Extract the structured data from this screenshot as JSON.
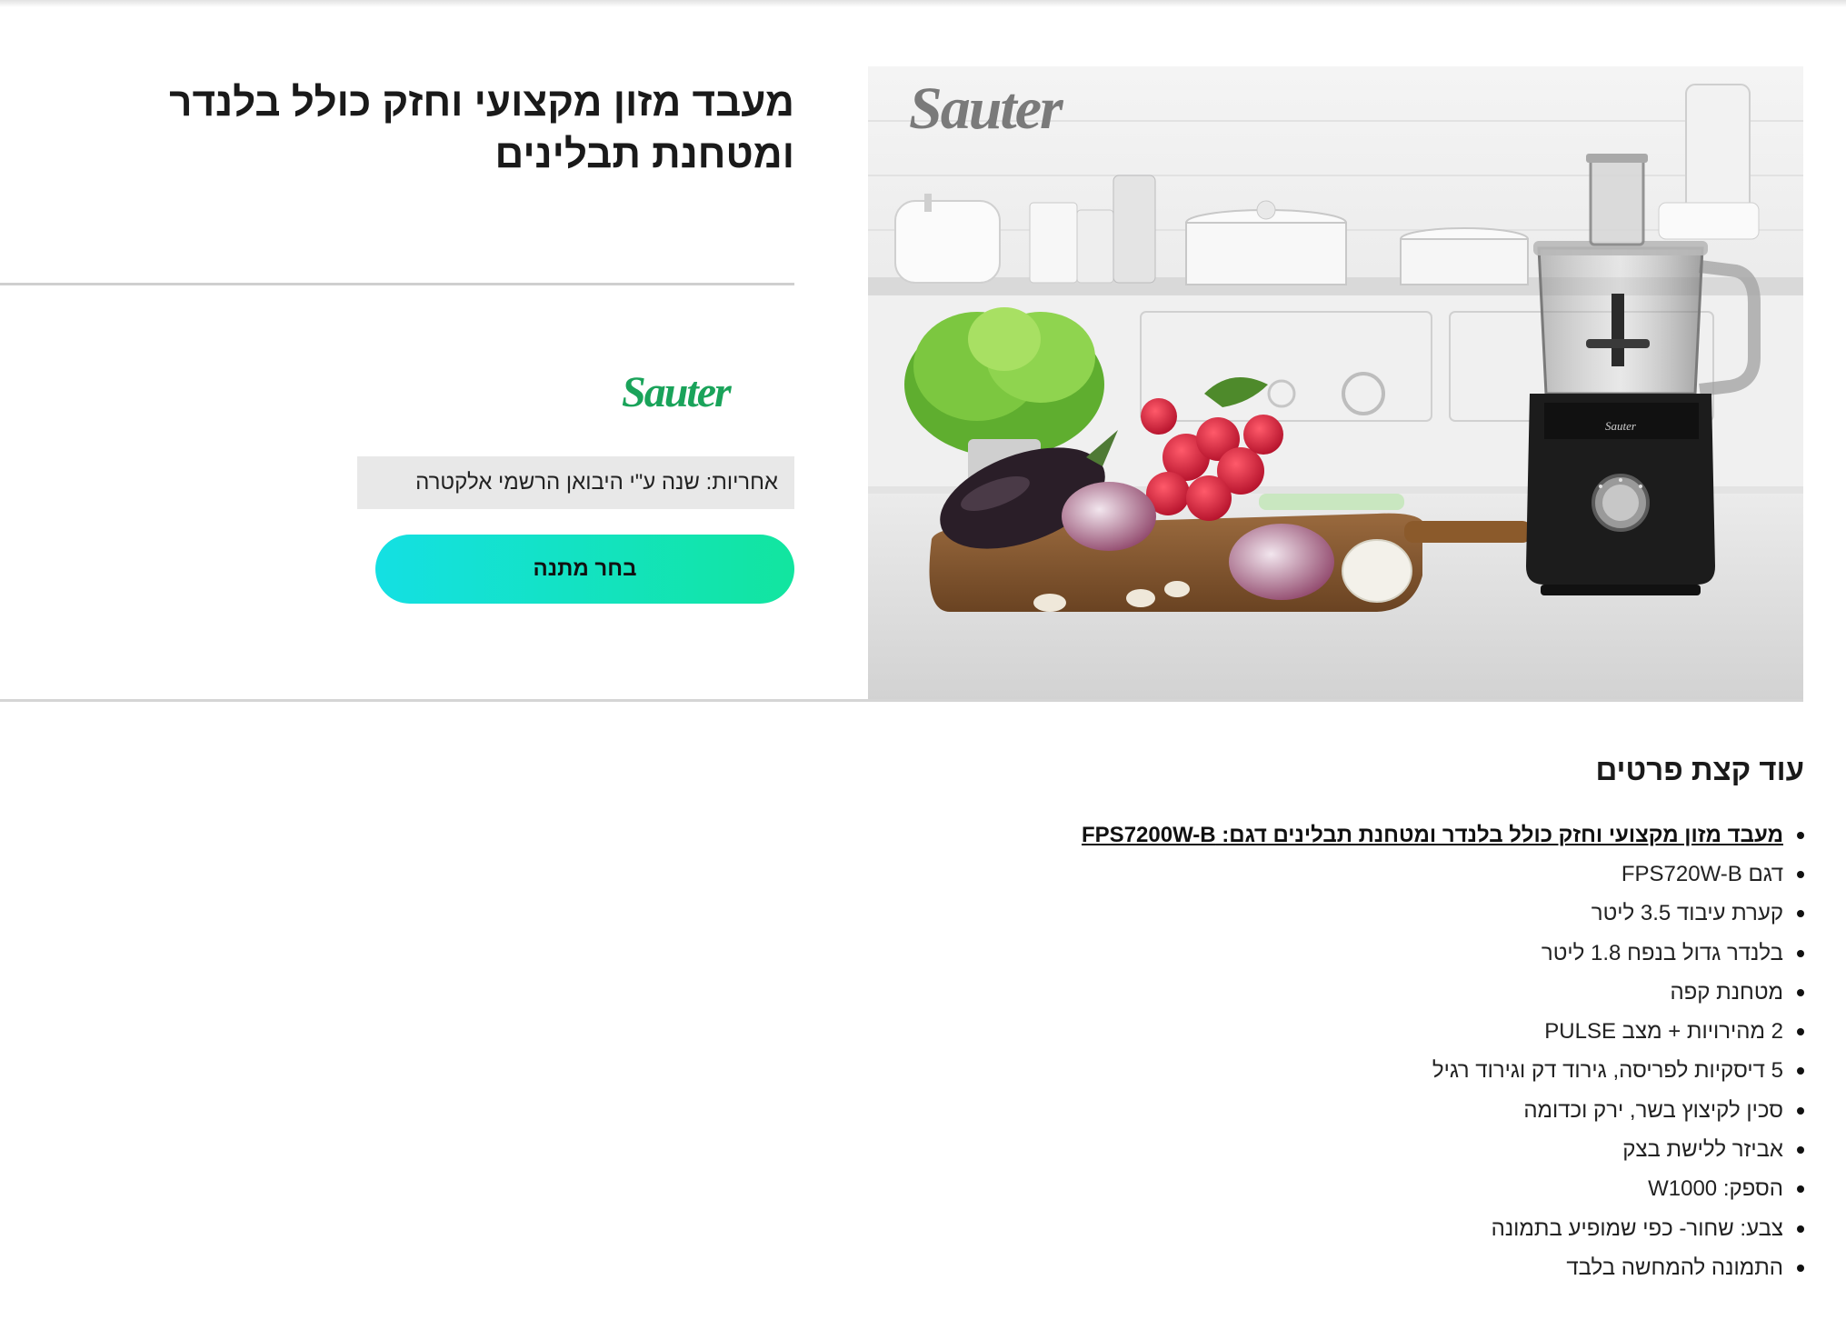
{
  "product": {
    "title": "מעבד מזון מקצועי וחזק כולל בלנדר ומטחנת תבלינים",
    "brand": "Sauter",
    "warranty": "אחריות: שנה ע\"י היבואן הרשמי אלקטרה",
    "cta_label": "בחר מתנה"
  },
  "details": {
    "heading": "עוד קצת פרטים",
    "features": [
      "מעבד מזון מקצועי וחזק כולל בלנדר ומטחנת תבלינים דגם: FPS7200W-B",
      "דגם FPS720W-B",
      "קערת עיבוד 3.5 ליטר",
      "בלנדר גדול בנפח 1.8 ליטר",
      "מטחנת קפה",
      "2 מהירויות + מצב PULSE",
      "5 דיסקיות לפריסה, גירוד דק וגירוד רגיל",
      "סכין לקיצוץ בשר, ירק וכדומה",
      "אביזר ללישת בצק",
      "הספק: W1000",
      "צבע: שחור- כפי שמופיע בתמונה",
      "התמונה להמחשה בלבד"
    ]
  },
  "colors": {
    "brand_green": "#1aa35a",
    "cta_gradient_start": "#14e0e3",
    "cta_gradient_end": "#12e59f",
    "warranty_bg": "#e8e8e8"
  }
}
